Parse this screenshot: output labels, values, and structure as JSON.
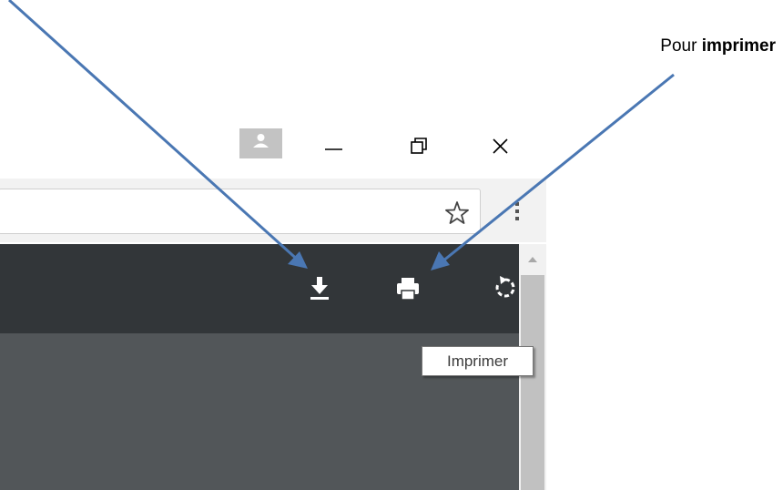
{
  "caption": {
    "prefix": "Pour ",
    "bold": "imprimer"
  },
  "window_controls": [
    {
      "name": "minimize",
      "icon": "minimize-icon"
    },
    {
      "name": "restore",
      "icon": "restore-icon"
    },
    {
      "name": "close",
      "icon": "close-icon"
    }
  ],
  "browser": {
    "profile_icon": "person-icon",
    "bookmark_icon": "star-icon",
    "menu_icon": "kebab-menu-icon"
  },
  "pdf_toolbar": {
    "icons": [
      "rotate-icon",
      "download-icon",
      "print-icon"
    ]
  },
  "tooltip": {
    "text": "Imprimer"
  },
  "colors": {
    "toolbar": "#323639",
    "content": "#525659",
    "arrow": "#4a77b3",
    "profile_bg": "#c3c3c3"
  }
}
